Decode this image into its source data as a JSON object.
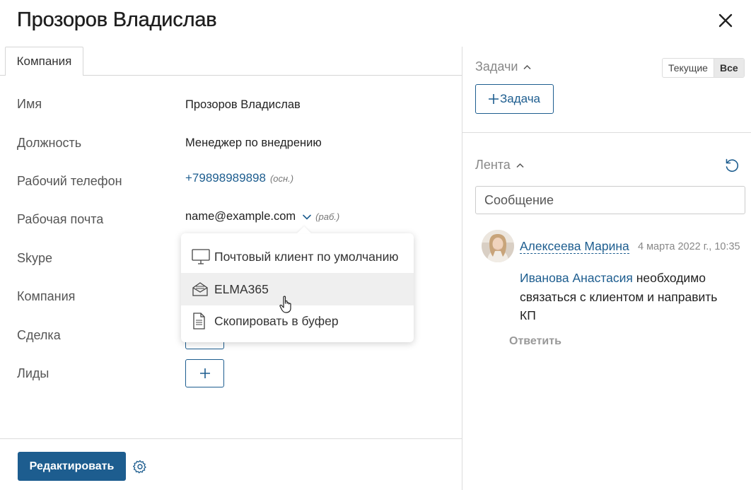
{
  "header": {
    "title": "Прозоров Владислав"
  },
  "tabs": [
    {
      "label": "Компания"
    }
  ],
  "fields": {
    "name": {
      "label": "Имя",
      "value": "Прозоров Владислав"
    },
    "position": {
      "label": "Должность",
      "value": "Менеджер по внедрению"
    },
    "phone": {
      "label": "Рабочий телефон",
      "value": "+79898989898",
      "hint": "(осн.)"
    },
    "email": {
      "label": "Рабочая почта",
      "value": "name@example.com",
      "hint": "(раб.)"
    },
    "skype": {
      "label": "Skype"
    },
    "company": {
      "label": "Компания"
    },
    "deal": {
      "label": "Сделка"
    },
    "leads": {
      "label": "Лиды"
    }
  },
  "email_menu": {
    "items": [
      {
        "label": "Почтовый клиент по умолчанию",
        "icon": "monitor-icon"
      },
      {
        "label": "ELMA365",
        "icon": "mail-envelope-icon"
      },
      {
        "label": "Скопировать в буфер",
        "icon": "document-icon"
      }
    ]
  },
  "footer": {
    "edit_label": "Редактировать"
  },
  "tasks": {
    "title": "Задачи",
    "filters": [
      "Текущие",
      "Все"
    ],
    "active_filter": "Все",
    "add_label": "Задача"
  },
  "feed": {
    "title": "Лента",
    "message_placeholder": "Сообщение",
    "post": {
      "author": "Алексеева Марина",
      "date": "4 марта 2022 г., 10:35",
      "mention": "Иванова Анастасия",
      "text": " необходимо связаться с клиентом и направить КП",
      "reply_label": "Ответить"
    }
  },
  "colors": {
    "accent": "#1d5d8f",
    "hover": "#efefef"
  }
}
